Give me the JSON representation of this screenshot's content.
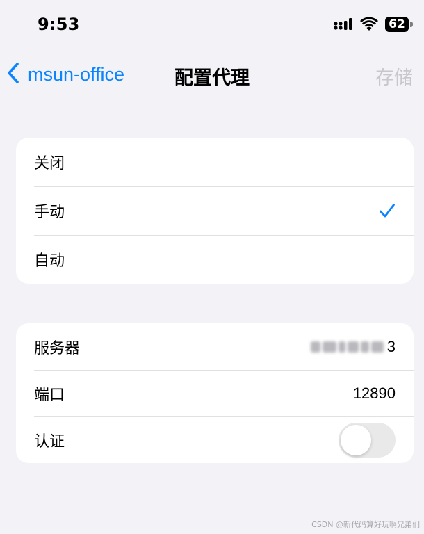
{
  "status_bar": {
    "time": "9:53",
    "battery": "62",
    "icons": [
      "cellular-signal-icon",
      "wifi-icon",
      "battery-icon"
    ]
  },
  "nav": {
    "back_label": "msun-office",
    "title": "配置代理",
    "save_label": "存储",
    "accent_color": "#0a84ff",
    "disabled_color": "#c7c7cc"
  },
  "proxy_modes": {
    "options": [
      {
        "label": "关闭",
        "selected": false
      },
      {
        "label": "手动",
        "selected": true
      },
      {
        "label": "自动",
        "selected": false
      }
    ]
  },
  "manual_settings": {
    "server_label": "服务器",
    "server_value_visible_tail": "3",
    "port_label": "端口",
    "port_value": "12890",
    "auth_label": "认证",
    "auth_enabled": false
  },
  "watermark": "CSDN @新代码算好玩啊兄弟们"
}
